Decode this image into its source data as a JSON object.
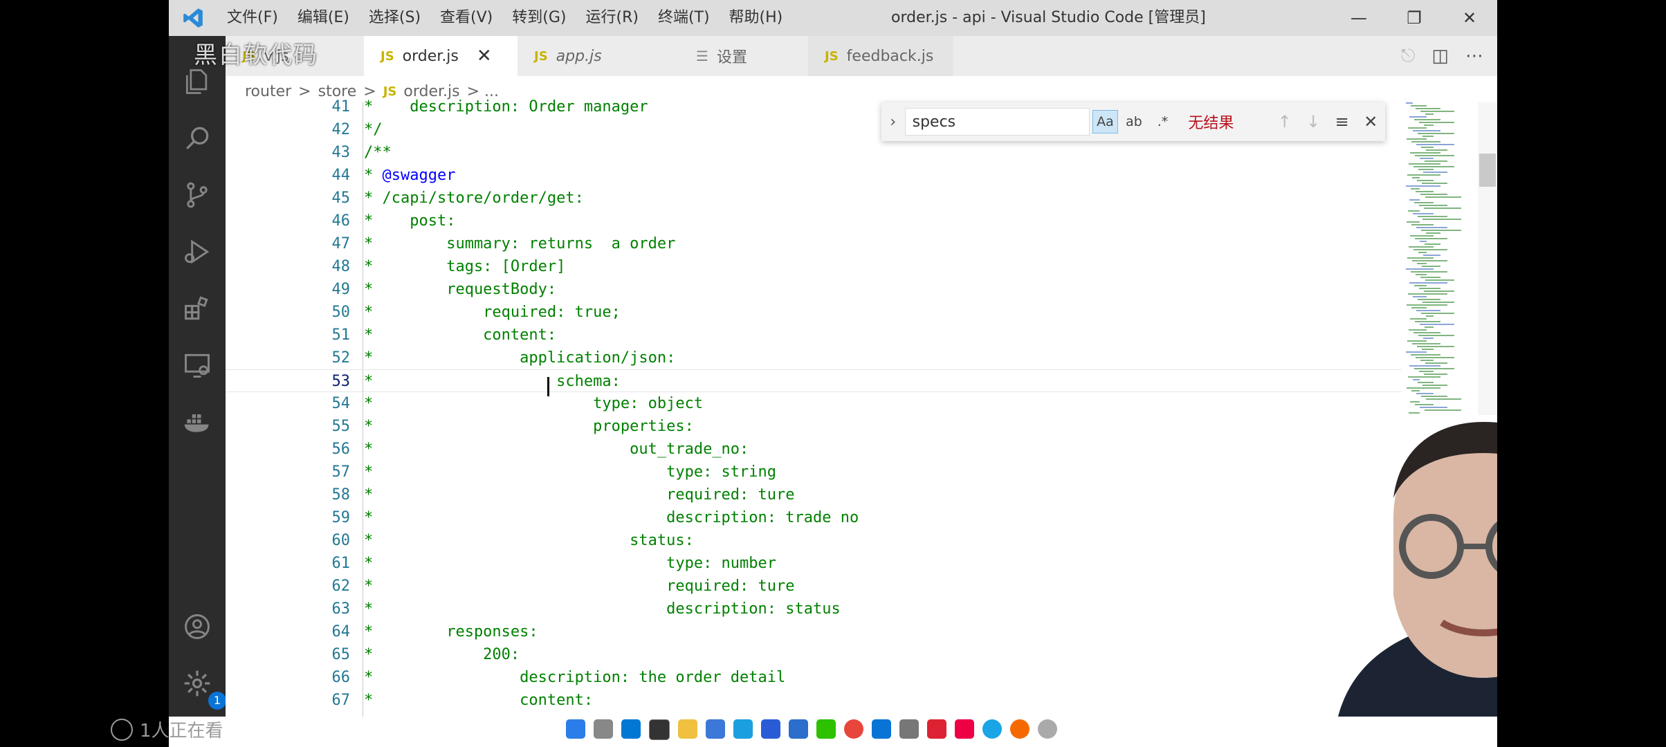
{
  "window": {
    "title": "order.js - api - Visual Studio Code [管理员]"
  },
  "menu": [
    "文件(F)",
    "编辑(E)",
    "选择(S)",
    "查看(V)",
    "转到(G)",
    "运行(R)",
    "终端(T)",
    "帮助(H)"
  ],
  "tabs": [
    {
      "label": "v.js",
      "type": "js",
      "active": false
    },
    {
      "label": "order.js",
      "type": "js",
      "active": true
    },
    {
      "label": "app.js",
      "type": "js",
      "active": false
    },
    {
      "label": "设置",
      "type": "settings",
      "active": false
    },
    {
      "label": "feedback.js",
      "type": "js",
      "active": false
    }
  ],
  "breadcrumb": {
    "parts": [
      "router",
      ">",
      "store",
      ">"
    ],
    "js_label": "JS",
    "file": "order.js",
    "tail": "> ..."
  },
  "find": {
    "value": "specs",
    "match_case": "Aa",
    "whole_word": "ab",
    "regex": ".*",
    "result": "无结果"
  },
  "editor": {
    "current_line": 53,
    "lines": [
      {
        "n": "41",
        "text": "*    description: Order manager"
      },
      {
        "n": "42",
        "text": "*/"
      },
      {
        "n": "43",
        "text": "/**"
      },
      {
        "n": "44",
        "text": "* @swagger"
      },
      {
        "n": "45",
        "text": "* /capi/store/order/get:"
      },
      {
        "n": "46",
        "text": "*    post:"
      },
      {
        "n": "47",
        "text": "*        summary: returns  a order"
      },
      {
        "n": "48",
        "text": "*        tags: [Order]"
      },
      {
        "n": "49",
        "text": "*        requestBody:"
      },
      {
        "n": "50",
        "text": "*            required: true;"
      },
      {
        "n": "51",
        "text": "*            content:"
      },
      {
        "n": "52",
        "text": "*                application/json:"
      },
      {
        "n": "53",
        "text": "*                    schema:"
      },
      {
        "n": "54",
        "text": "*                        type: object"
      },
      {
        "n": "55",
        "text": "*                        properties:"
      },
      {
        "n": "56",
        "text": "*                            out_trade_no:"
      },
      {
        "n": "57",
        "text": "*                                type: string"
      },
      {
        "n": "58",
        "text": "*                                required: ture"
      },
      {
        "n": "59",
        "text": "*                                description: trade no"
      },
      {
        "n": "60",
        "text": "*                            status:"
      },
      {
        "n": "61",
        "text": "*                                type: number"
      },
      {
        "n": "62",
        "text": "*                                required: ture"
      },
      {
        "n": "63",
        "text": "*                                description: status"
      },
      {
        "n": "64",
        "text": "*        responses:"
      },
      {
        "n": "65",
        "text": "*            200:"
      },
      {
        "n": "66",
        "text": "*                description: the order detail"
      },
      {
        "n": "67",
        "text": "*                content:"
      }
    ]
  },
  "activity_badge": "1",
  "overlay": {
    "viewers": "1人正在看",
    "watermark": "黑白软代码"
  },
  "colors": {
    "comment": "#008000",
    "line_number": "#237893",
    "activity_bar": "#2c2c2c",
    "accent": "#0a74d6"
  }
}
